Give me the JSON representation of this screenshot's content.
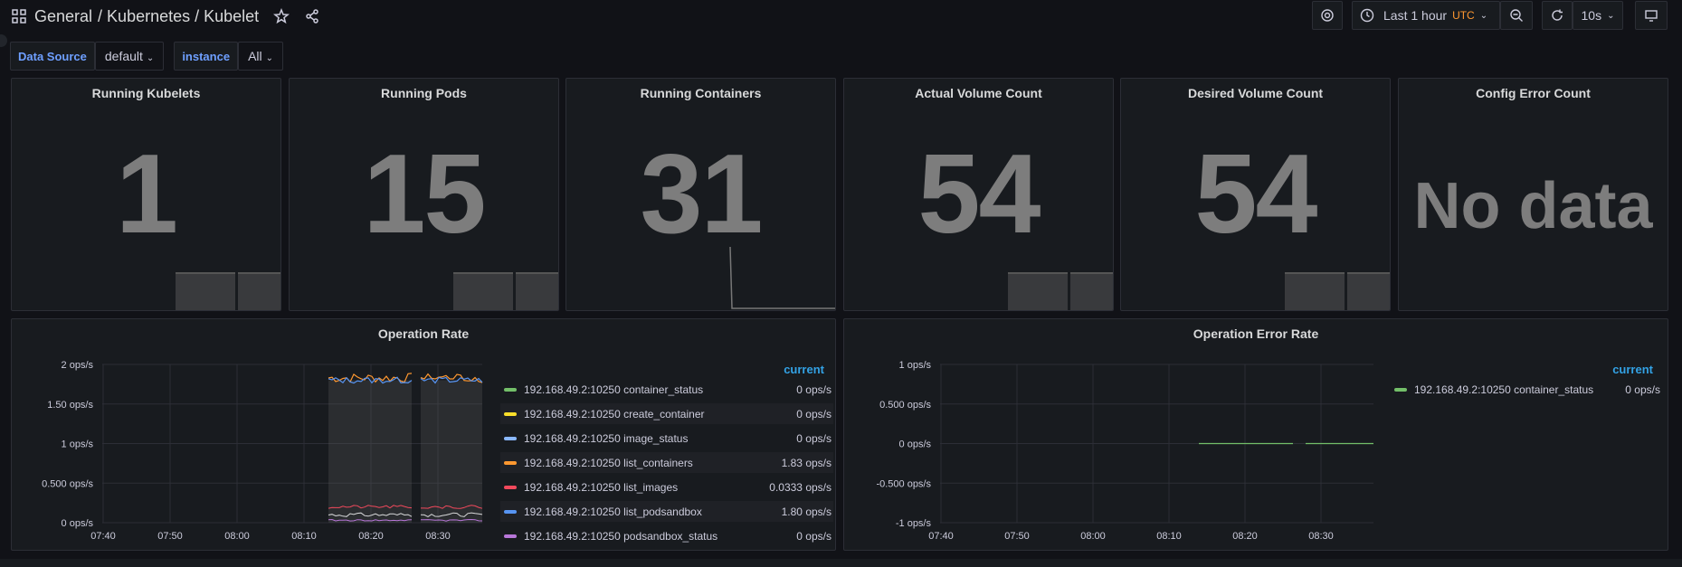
{
  "breadcrumb": {
    "folder": "General",
    "title": "/ Kubernetes / Kubelet"
  },
  "toolbar": {
    "time_range": "Last 1 hour",
    "timezone": "UTC",
    "refresh": "10s"
  },
  "variables": [
    {
      "label": "Data Source",
      "value": "default"
    },
    {
      "label": "instance",
      "value": "All"
    }
  ],
  "stats": [
    {
      "title": "Running Kubelets",
      "value": "1"
    },
    {
      "title": "Running Pods",
      "value": "15"
    },
    {
      "title": "Running Containers",
      "value": "31"
    },
    {
      "title": "Actual Volume Count",
      "value": "54"
    },
    {
      "title": "Desired Volume Count",
      "value": "54"
    },
    {
      "title": "Config Error Count",
      "value": "No data"
    }
  ],
  "colors": {
    "green": "#73bf69",
    "yellow": "#fade2a",
    "cyan": "#5794f2",
    "orange": "#ff9830",
    "red": "#f2495c",
    "blue": "#3274d9",
    "purple": "#b877d9",
    "accent": "#33a2e5"
  },
  "chart_data": [
    {
      "type": "line",
      "title": "Operation Rate",
      "x_ticks": [
        "07:40",
        "07:50",
        "08:00",
        "08:10",
        "08:20",
        "08:30"
      ],
      "y_ticks": [
        "2 ops/s",
        "1.50 ops/s",
        "1 ops/s",
        "0.500 ops/s",
        "0 ops/s"
      ],
      "ylim": [
        0,
        2
      ],
      "legend_header": "current",
      "series": [
        {
          "name": "192.168.49.2:10250 container_status",
          "current": "0 ops/s",
          "color": "#73bf69"
        },
        {
          "name": "192.168.49.2:10250 create_container",
          "current": "0 ops/s",
          "color": "#fade2a"
        },
        {
          "name": "192.168.49.2:10250 image_status",
          "current": "0 ops/s",
          "color": "#8ab8ff"
        },
        {
          "name": "192.168.49.2:10250 list_containers",
          "current": "1.83 ops/s",
          "color": "#ff9830"
        },
        {
          "name": "192.168.49.2:10250 list_images",
          "current": "0.0333 ops/s",
          "color": "#f2495c"
        },
        {
          "name": "192.168.49.2:10250 list_podsandbox",
          "current": "1.80 ops/s",
          "color": "#5794f2"
        },
        {
          "name": "192.168.49.2:10250 podsandbox_status",
          "current": "0 ops/s",
          "color": "#b877d9"
        }
      ]
    },
    {
      "type": "line",
      "title": "Operation Error Rate",
      "x_ticks": [
        "07:40",
        "07:50",
        "08:00",
        "08:10",
        "08:20",
        "08:30"
      ],
      "y_ticks": [
        "1 ops/s",
        "0.500 ops/s",
        "0 ops/s",
        "-0.500 ops/s",
        "-1 ops/s"
      ],
      "ylim": [
        -1,
        1
      ],
      "legend_header": "current",
      "series": [
        {
          "name": "192.168.49.2:10250 container_status",
          "current": "0 ops/s",
          "color": "#73bf69"
        }
      ]
    }
  ]
}
